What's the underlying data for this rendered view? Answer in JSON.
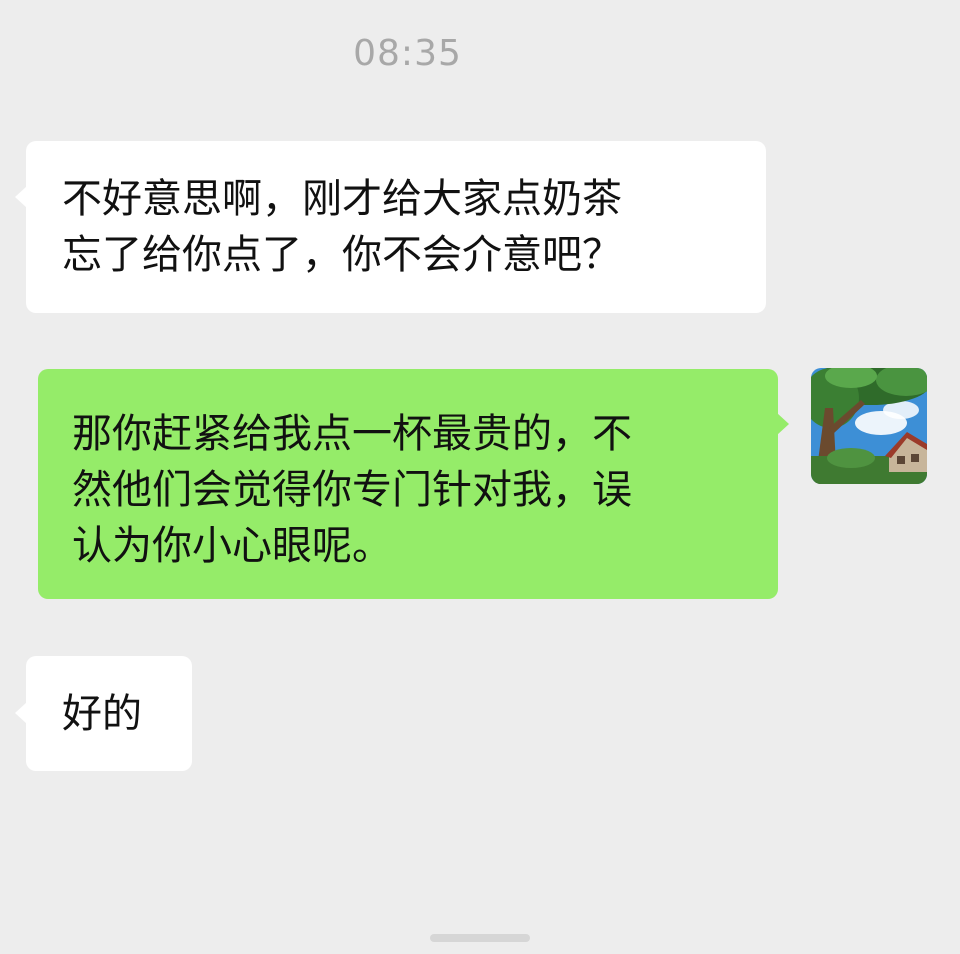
{
  "chat": {
    "timestamp": "08:35",
    "messages": [
      {
        "sender": "other",
        "lines": [
          "不好意思啊，刚才给大家点奶茶",
          "忘了给你点了，你不会介意吧？"
        ]
      },
      {
        "sender": "me",
        "lines": [
          "那你赶紧给我点一杯最贵的，不",
          "然他们会觉得你专门针对我，误",
          "认为你小心眼呢。"
        ]
      },
      {
        "sender": "other",
        "lines": [
          "好的"
        ]
      }
    ]
  },
  "colors": {
    "background": "#ededed",
    "incoming_bubble": "#ffffff",
    "outgoing_bubble": "#95ec69",
    "timestamp_text": "#a8a8a8",
    "message_text": "#111111"
  },
  "avatar": {
    "icon": "user-avatar-tree-landscape"
  }
}
